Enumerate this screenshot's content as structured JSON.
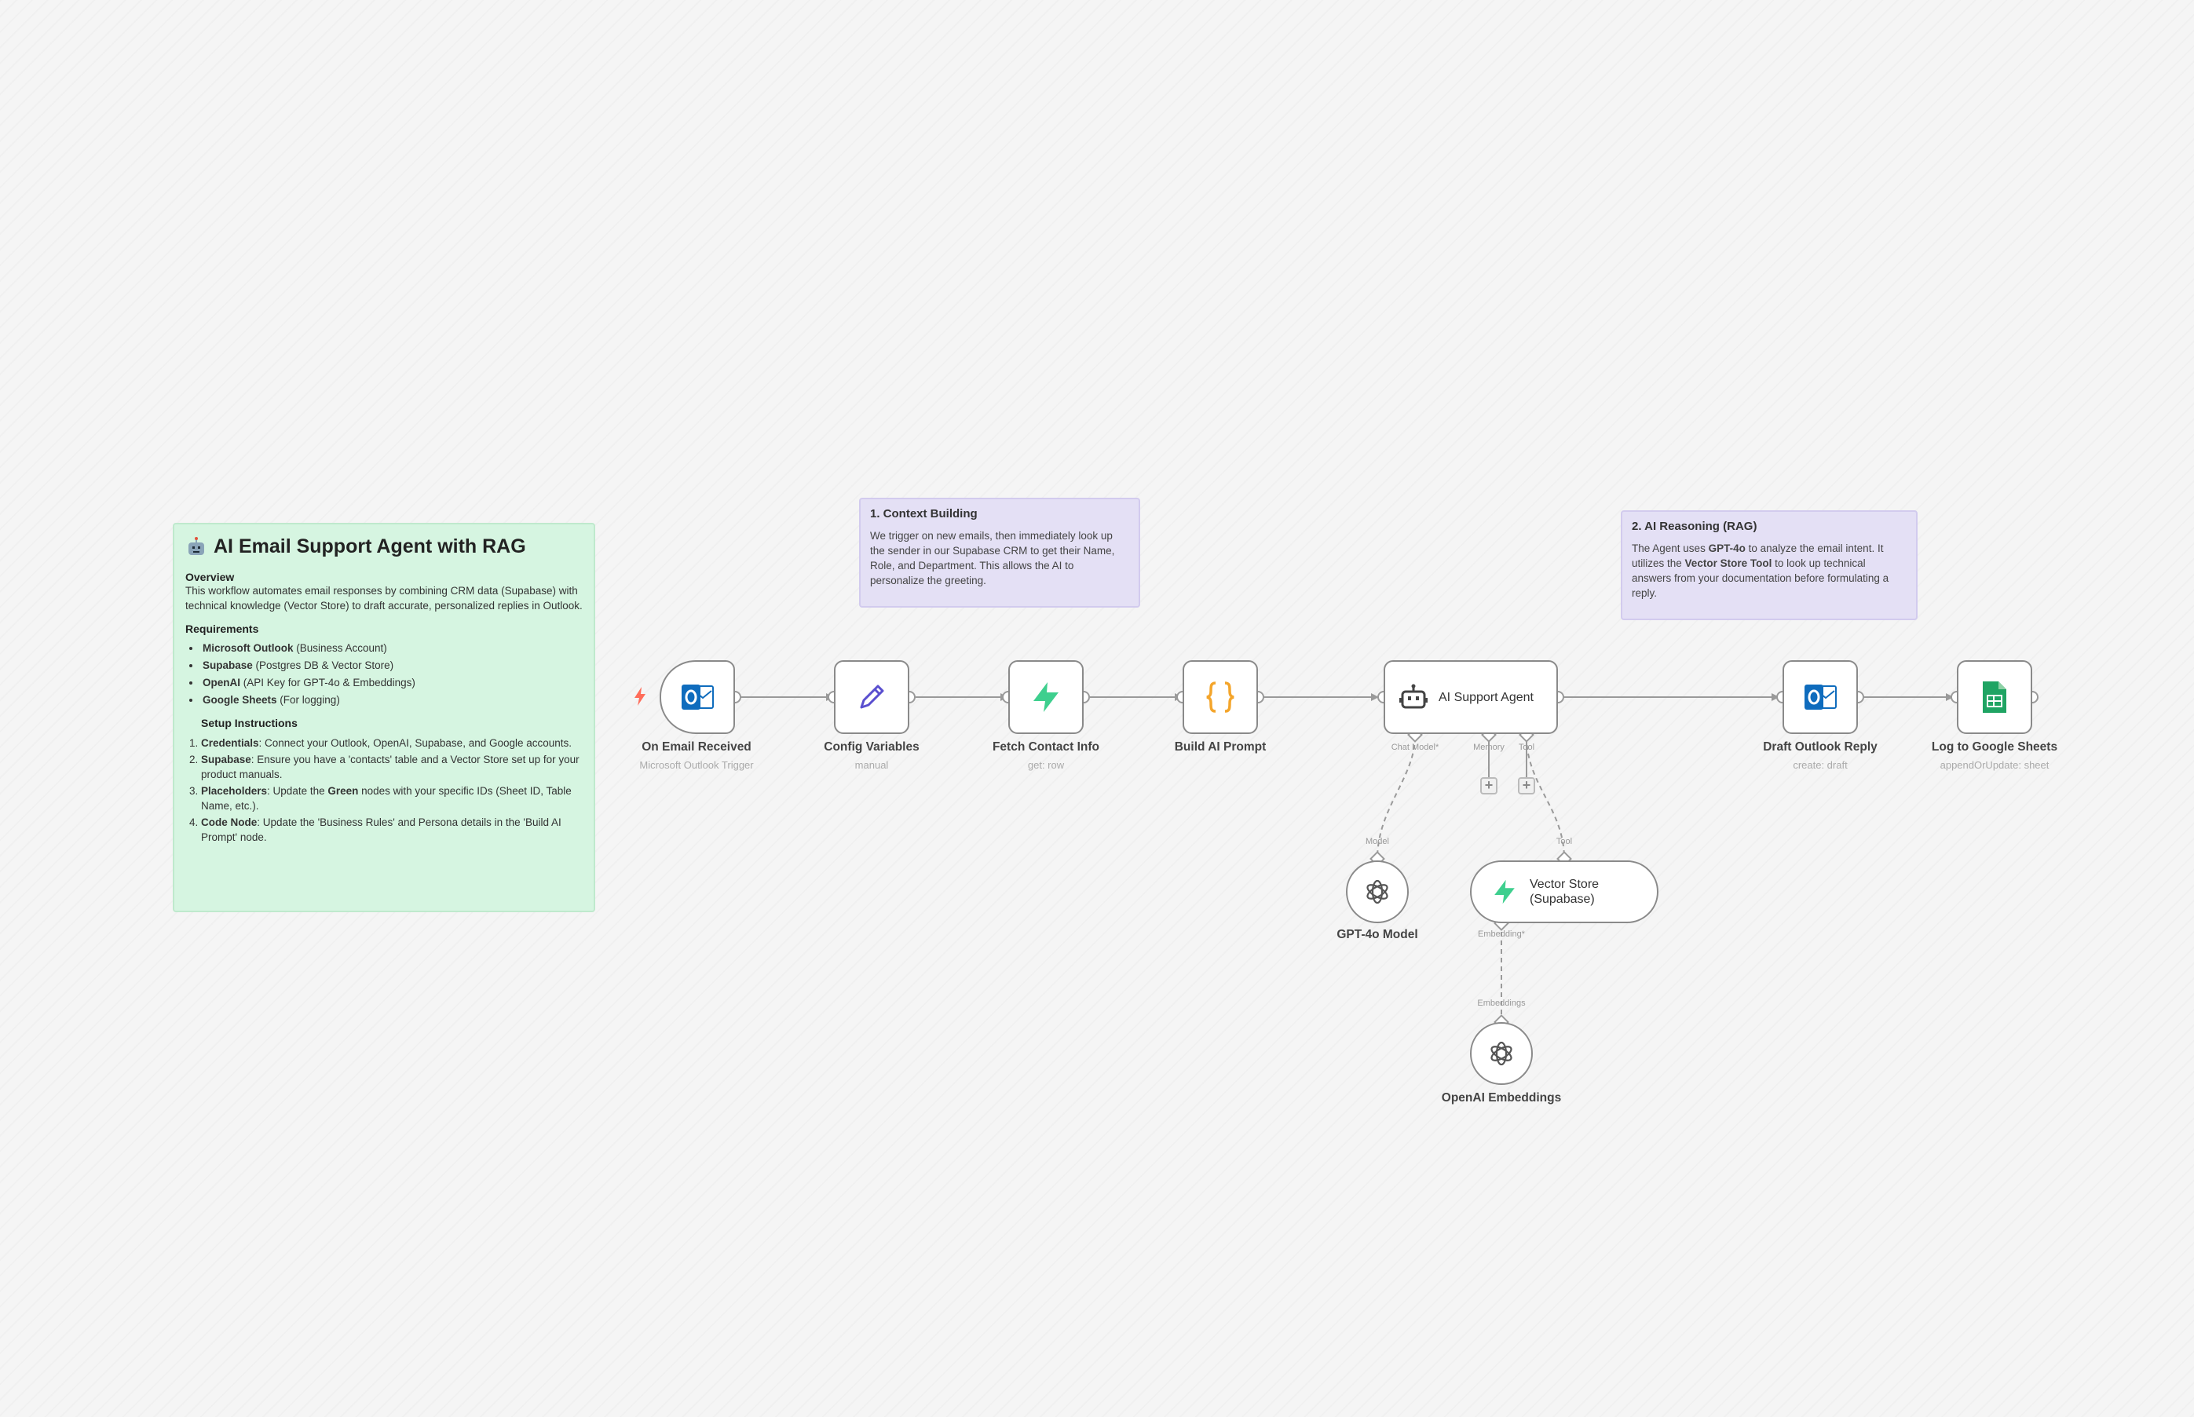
{
  "colors": {
    "edge": "#9a9a9a",
    "sticky_green": "#d6f5e1",
    "sticky_purple": "#e4e0f5",
    "outlook_blue": "#0f6cbd",
    "supabase_green": "#3ecf8e",
    "code_orange": "#f4a52b",
    "sheets_green": "#1fa463",
    "edit_purple": "#5a4fcf",
    "trigger_red": "#ff6d5a"
  },
  "sticky_main": {
    "title": "AI Email Support Agent with RAG",
    "title_icon": "robot-emoji",
    "overview_heading": "Overview",
    "overview_text": "This workflow automates email responses by combining CRM data (Supabase) with technical knowledge (Vector Store) to draft accurate, personalized replies in Outlook.",
    "requirements_heading": "Requirements",
    "requirements": [
      {
        "bold": "Microsoft Outlook",
        "text": " (Business Account)"
      },
      {
        "bold": "Supabase",
        "text": " (Postgres DB & Vector Store)"
      },
      {
        "bold": "OpenAI",
        "text": " (API Key for GPT-4o & Embeddings)"
      },
      {
        "bold": "Google Sheets",
        "text": " (For logging)"
      }
    ],
    "setup_heading": "Setup Instructions",
    "setup": [
      {
        "bold": "Credentials",
        "text": ": Connect your Outlook, OpenAI, Supabase, and Google accounts."
      },
      {
        "bold": "Supabase",
        "text": ": Ensure you have a 'contacts' table and a Vector Store set up for your product manuals."
      },
      {
        "bold": "Placeholders",
        "pre": ": Update the ",
        "bold2": "Green",
        "text": " nodes with your specific IDs (Sheet ID, Table Name, etc.)."
      },
      {
        "bold": "Code Node",
        "text": ": Update the 'Business Rules' and Persona details in the 'Build AI Prompt' node."
      }
    ]
  },
  "sticky_context": {
    "title": "1. Context Building",
    "body": "We trigger on new emails, then immediately look up the sender in our Supabase CRM to get their Name, Role, and Department. This allows the AI to personalize the greeting."
  },
  "sticky_ai": {
    "title": "2. AI Reasoning (RAG)",
    "pre": "The Agent uses ",
    "bold1": "GPT-4o",
    "mid": " to analyze the email intent. It utilizes the ",
    "bold2": "Vector Store Tool",
    "post": " to look up technical answers from your documentation before formulating a reply."
  },
  "nodes": {
    "email_trigger": {
      "label": "On Email Received",
      "sub": "Microsoft Outlook Trigger",
      "icon": "outlook-icon"
    },
    "config": {
      "label": "Config Variables",
      "sub": "manual",
      "icon": "pencil-icon"
    },
    "fetch_contact": {
      "label": "Fetch Contact Info",
      "sub": "get: row",
      "icon": "supabase-icon"
    },
    "build_prompt": {
      "label": "Build AI Prompt",
      "sub": "",
      "icon": "curly-braces-icon"
    },
    "agent": {
      "label": "AI Support Agent",
      "icon": "robot-icon",
      "ports": {
        "chat_model": "Chat Model*",
        "memory": "Memory",
        "tool": "Tool"
      }
    },
    "draft_reply": {
      "label": "Draft Outlook Reply",
      "sub": "create: draft",
      "icon": "outlook-icon"
    },
    "log_sheets": {
      "label": "Log to Google Sheets",
      "sub": "appendOrUpdate: sheet",
      "icon": "google-sheets-icon"
    },
    "gpt_model": {
      "label": "GPT-4o Model",
      "port": "Model",
      "icon": "openai-icon"
    },
    "vector_store": {
      "label": "Vector Store (Supabase)",
      "line1": "Vector Store",
      "line2": "(Supabase)",
      "port_in": "Tool",
      "port_out": "Embedding*",
      "icon": "supabase-icon"
    },
    "embeddings": {
      "label": "OpenAI Embeddings",
      "port": "Embeddings",
      "icon": "openai-icon"
    }
  },
  "plus_symbol": "+"
}
